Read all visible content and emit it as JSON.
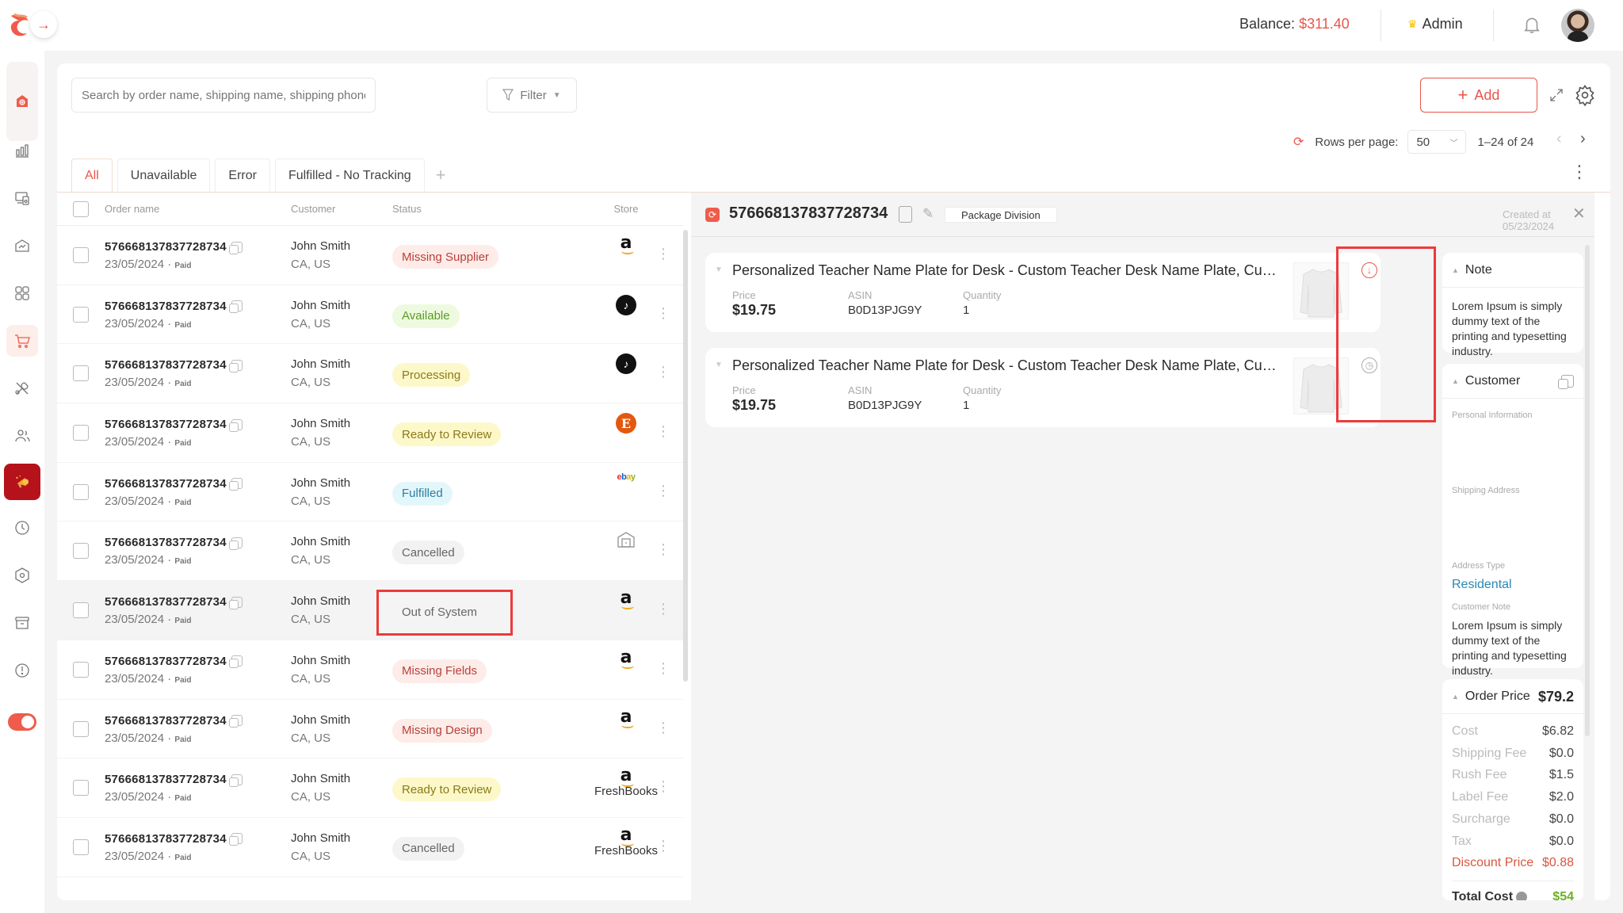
{
  "header": {
    "balance_label": "Balance:",
    "balance_value": "$311.40",
    "role": "Admin",
    "icons": [
      "logo-icon",
      "expand-arrow-icon",
      "crown-icon",
      "bell-icon",
      "avatar"
    ]
  },
  "sidebar": {
    "items": [
      {
        "icon": "shop-icon",
        "label": "Store",
        "active": true
      },
      {
        "icon": "bar-chart-icon",
        "label": "Analytics"
      },
      {
        "icon": "devices-icon",
        "label": "Devices"
      },
      {
        "icon": "trend-icon",
        "label": "Reports"
      },
      {
        "icon": "grid-icon",
        "label": "Apps"
      },
      {
        "icon": "cart-icon",
        "label": "Orders",
        "selected": true
      },
      {
        "icon": "tools-icon",
        "label": "Tools"
      },
      {
        "icon": "users-icon",
        "label": "Users"
      },
      {
        "icon": "megaphone-icon",
        "label": "Promotions"
      },
      {
        "icon": "clock-icon",
        "label": "History"
      },
      {
        "icon": "settings-hex-icon",
        "label": "Settings"
      },
      {
        "icon": "archive-icon",
        "label": "Archive"
      },
      {
        "icon": "alert-icon",
        "label": "Alerts"
      }
    ],
    "toggle_on": true
  },
  "toolbar": {
    "search_placeholder": "Search by order name, shipping name, shipping phone",
    "filter_label": "Filter",
    "add_label": "Add",
    "rows_per_page_label": "Rows per page:",
    "rows_per_page_value": "50",
    "range": "1–24 of 24"
  },
  "tabs": [
    {
      "label": "All",
      "active": true
    },
    {
      "label": "Unavailable"
    },
    {
      "label": "Error"
    },
    {
      "label": "Fulfilled - No Tracking"
    }
  ],
  "table": {
    "columns": [
      "Order name",
      "Customer",
      "Status",
      "Store"
    ],
    "rows": [
      {
        "order": "576668137837728734",
        "date": "23/05/2024",
        "payment": "Paid",
        "customer": "John Smith",
        "location": "CA, US",
        "status": "Missing Supplier",
        "status_type": "red",
        "store": "amazon",
        "store_name": ""
      },
      {
        "order": "576668137837728734",
        "date": "23/05/2024",
        "payment": "Paid",
        "customer": "John Smith",
        "location": "CA, US",
        "status": "Available",
        "status_type": "green",
        "store": "tiktok",
        "store_name": ""
      },
      {
        "order": "576668137837728734",
        "date": "23/05/2024",
        "payment": "Paid",
        "customer": "John Smith",
        "location": "CA, US",
        "status": "Processing",
        "status_type": "yellow",
        "store": "tiktok",
        "store_name": ""
      },
      {
        "order": "576668137837728734",
        "date": "23/05/2024",
        "payment": "Paid",
        "customer": "John Smith",
        "location": "CA, US",
        "status": "Ready to Review",
        "status_type": "yellow",
        "store": "etsy",
        "store_name": ""
      },
      {
        "order": "576668137837728734",
        "date": "23/05/2024",
        "payment": "Paid",
        "customer": "John Smith",
        "location": "CA, US",
        "status": "Fulfilled",
        "status_type": "blue",
        "store": "ebay",
        "store_name": ""
      },
      {
        "order": "576668137837728734",
        "date": "23/05/2024",
        "payment": "Paid",
        "customer": "John Smith",
        "location": "CA, US",
        "status": "Cancelled",
        "status_type": "gray",
        "store": "warehouse",
        "store_name": ""
      },
      {
        "order": "576668137837728734",
        "date": "23/05/2024",
        "payment": "Paid",
        "customer": "John Smith",
        "location": "CA, US",
        "status": "Out of System",
        "status_type": "none",
        "store": "amazon",
        "store_name": "",
        "highlighted": true
      },
      {
        "order": "576668137837728734",
        "date": "23/05/2024",
        "payment": "Paid",
        "customer": "John Smith",
        "location": "CA, US",
        "status": "Missing Fields",
        "status_type": "red",
        "store": "amazon",
        "store_name": ""
      },
      {
        "order": "576668137837728734",
        "date": "23/05/2024",
        "payment": "Paid",
        "customer": "John Smith",
        "location": "CA, US",
        "status": "Missing Design",
        "status_type": "red",
        "store": "amazon",
        "store_name": ""
      },
      {
        "order": "576668137837728734",
        "date": "23/05/2024",
        "payment": "Paid",
        "customer": "John Smith",
        "location": "CA, US",
        "status": "Ready to Review",
        "status_type": "yellow",
        "store": "amazon",
        "store_name": "FreshBooks"
      },
      {
        "order": "576668137837728734",
        "date": "23/05/2024",
        "payment": "Paid",
        "customer": "John Smith",
        "location": "CA, US",
        "status": "Cancelled",
        "status_type": "gray",
        "store": "amazon",
        "store_name": "FreshBooks"
      }
    ]
  },
  "status_colors": {
    "red": {
      "bg": "#fdece8",
      "fg": "#b9403a"
    },
    "green": {
      "bg": "#eefadf",
      "fg": "#5c9a2a"
    },
    "yellow": {
      "bg": "#fdf8c9",
      "fg": "#8a7a1a"
    },
    "blue": {
      "bg": "#e3f7fb",
      "fg": "#2c7ea1"
    },
    "gray": {
      "bg": "#f2f2f2",
      "fg": "#666666"
    },
    "none": {
      "bg": "transparent",
      "fg": "#666666"
    }
  },
  "detail": {
    "order_id": "576668137837728734",
    "package_division_label": "Package Division",
    "created_at": "Created at 05/23/2024",
    "items": [
      {
        "title": "Personalized Teacher Name Plate for Desk - Custom Teacher Desk Name Plate, Custom Teacher Gift",
        "price_label": "Price",
        "price": "$19.75",
        "asin_label": "ASIN",
        "asin": "B0D13PJG9Y",
        "qty_label": "Quantity",
        "qty": "1",
        "status_icon": "download-icon"
      },
      {
        "title": "Personalized Teacher Name Plate for Desk - Custom Teacher Desk Name Plate, Custom Teacher Gift",
        "price_label": "Price",
        "price": "$19.75",
        "asin_label": "ASIN",
        "asin": "B0D13PJG9Y",
        "qty_label": "Quantity",
        "qty": "1",
        "status_icon": "clock-icon"
      }
    ],
    "note": {
      "title": "Note",
      "text": "Lorem Ipsum is simply dummy text of the printing and typesetting industry."
    },
    "customer": {
      "title": "Customer",
      "personal_info_label": "Personal Information",
      "shipping_address_label": "Shipping Address",
      "address_type_label": "Address Type",
      "address_type": "Residental",
      "customer_note_label": "Customer Note",
      "customer_note": "Lorem Ipsum is simply dummy text of the printing and typesetting industry."
    },
    "order_price": {
      "title": "Order Price",
      "total": "$79.2",
      "lines": [
        {
          "label": "Cost",
          "value": "$6.82"
        },
        {
          "label": "Shipping Fee",
          "value": "$0.0"
        },
        {
          "label": "Rush Fee",
          "value": "$1.5"
        },
        {
          "label": "Label Fee",
          "value": "$2.0"
        },
        {
          "label": "Surcharge",
          "value": "$0.0"
        },
        {
          "label": "Tax",
          "value": "$0.0"
        },
        {
          "label": "Discount Price",
          "value": "$0.88",
          "discount": true
        }
      ],
      "total_cost_label": "Total Cost",
      "total_cost": "$54"
    }
  }
}
